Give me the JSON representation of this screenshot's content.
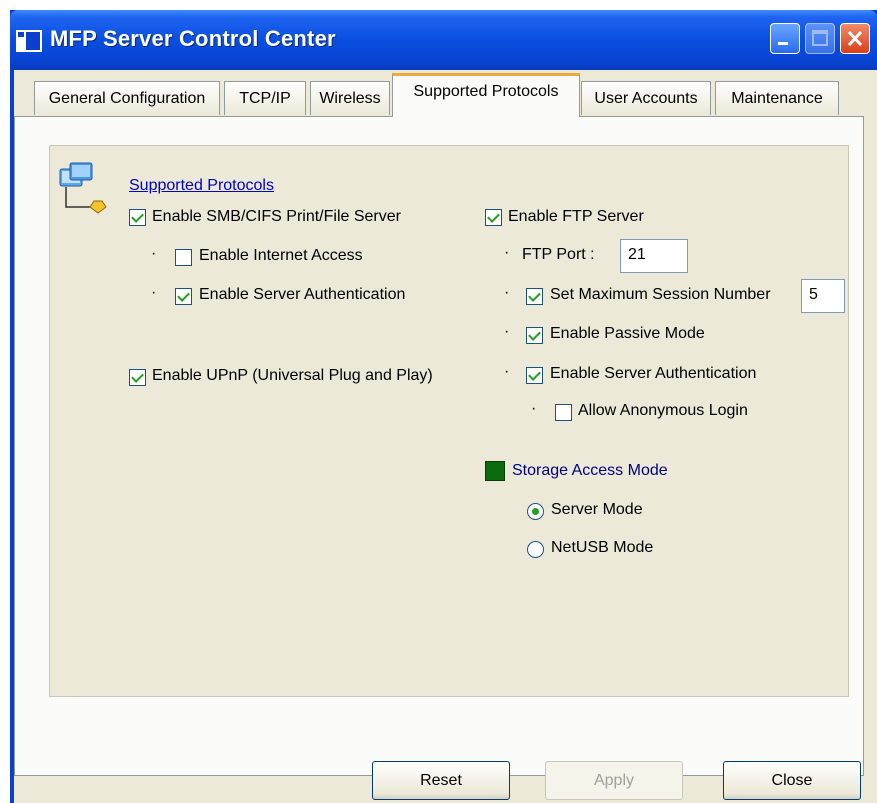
{
  "window": {
    "title": "MFP Server Control Center",
    "controls": [
      "minimize-icon",
      "maximize-icon",
      "close-icon"
    ],
    "title_bar_color": "#0a4fe0"
  },
  "tabs": [
    {
      "label": "General Configuration"
    },
    {
      "label": "TCP/IP"
    },
    {
      "label": "Wireless"
    },
    {
      "label": "Supported Protocols",
      "active": true
    },
    {
      "label": "User Accounts"
    },
    {
      "label": "Maintenance"
    }
  ],
  "supported_protocols": {
    "heading": "Supported Protocols",
    "smb": {
      "label": "Enable SMB/CIFS Print/File Server",
      "checked": true
    },
    "internet_access": {
      "label": "Enable Internet Access",
      "checked": false
    },
    "smb_auth": {
      "label": "Enable Server Authentication",
      "checked": true
    },
    "upnp": {
      "label": "Enable UPnP (Universal Plug and Play)",
      "checked": true
    },
    "ftp": {
      "label": "Enable FTP Server",
      "checked": true
    },
    "ftp_port": {
      "label": "FTP Port :",
      "value": "21"
    },
    "max_session": {
      "label": "Set Maximum Session Number",
      "checked": true,
      "value": "5"
    },
    "passive": {
      "label": "Enable Passive Mode",
      "checked": true
    },
    "ftp_auth": {
      "label": "Enable Server Authentication",
      "checked": true
    },
    "anonymous": {
      "label": "Allow Anonymous Login",
      "checked": false
    },
    "storage": {
      "title": "Storage Access Mode",
      "server_mode": {
        "label": "Server Mode",
        "selected": true
      },
      "netusb_mode": {
        "label": "NetUSB Mode",
        "selected": false
      }
    }
  },
  "buttons": {
    "reset": "Reset",
    "apply": "Apply",
    "close": "Close"
  },
  "colors": {
    "accent_green": "#0b6a0b",
    "check_green": "#21a121",
    "link_blue": "#0000cc",
    "tab_highlight": "#f3a83d"
  }
}
